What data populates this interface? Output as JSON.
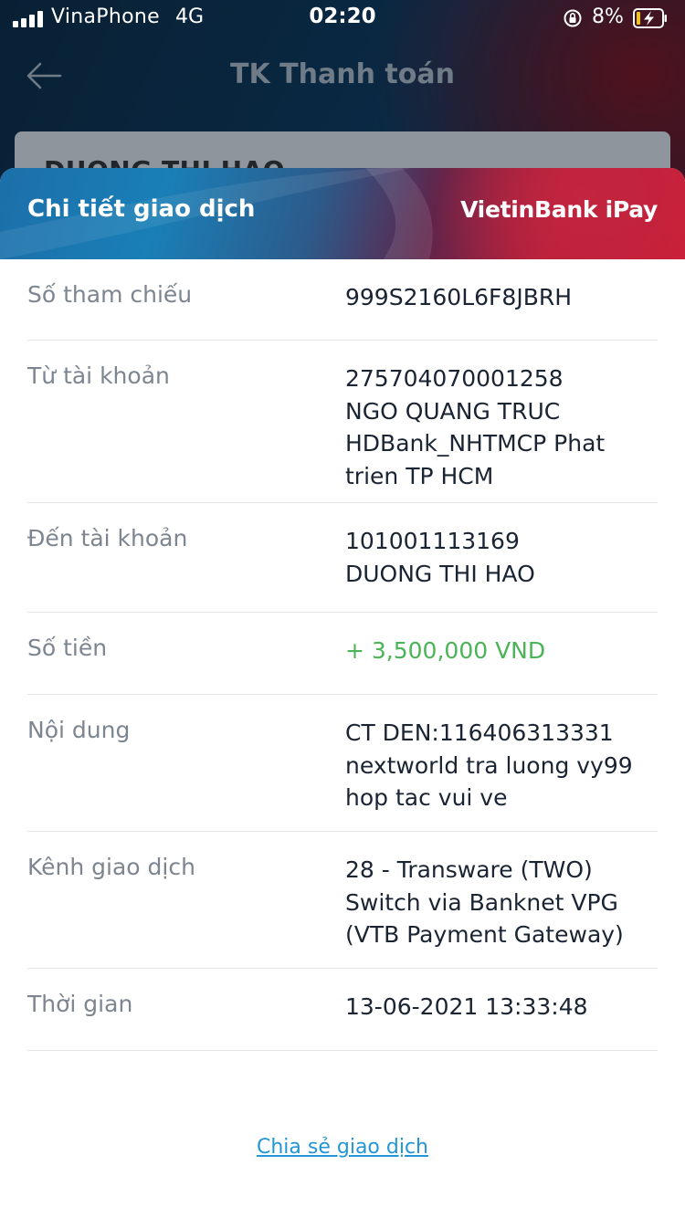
{
  "status_bar": {
    "carrier": "VinaPhone",
    "network": "4G",
    "time": "02:20",
    "battery_percent": "8%",
    "icons": [
      "signal-icon",
      "orientation-lock-icon",
      "battery-charging-icon"
    ]
  },
  "background": {
    "screen_title": "TK Thanh toán",
    "account_name": "DUONG THI HAO"
  },
  "sheet": {
    "title": "Chi tiết giao dịch",
    "brand": "VietinBank iPay",
    "rows": [
      {
        "label": "Số tham chiếu",
        "lines": [
          "999S2160L6F8JBRH"
        ]
      },
      {
        "label": "Từ tài khoản",
        "lines": [
          "275704070001258",
          "NGO QUANG TRUC",
          "HDBank_NHTMCP Phat",
          "trien TP HCM"
        ]
      },
      {
        "label": "Đến tài khoản",
        "lines": [
          "101001113169",
          "DUONG THI HAO"
        ]
      },
      {
        "label": "Số tiền",
        "lines": [
          "+ 3,500,000 VND"
        ]
      },
      {
        "label": "Nội dung",
        "lines": [
          "CT DEN:116406313331",
          "nextworld tra luong vy99",
          "hop tac vui ve"
        ]
      },
      {
        "label": "Kênh giao dịch",
        "lines": [
          "28 - Transware (TWO)",
          "Switch via Banknet VPG",
          "(VTB Payment Gateway)"
        ]
      },
      {
        "label": "Thời gian",
        "lines": [
          "13-06-2021 13:33:48"
        ]
      }
    ],
    "share_link": "Chia sẻ giao dịch"
  },
  "colors": {
    "amount": "#4ab457",
    "link": "#2295d6",
    "label": "#7c8590",
    "value": "#1a2433"
  }
}
